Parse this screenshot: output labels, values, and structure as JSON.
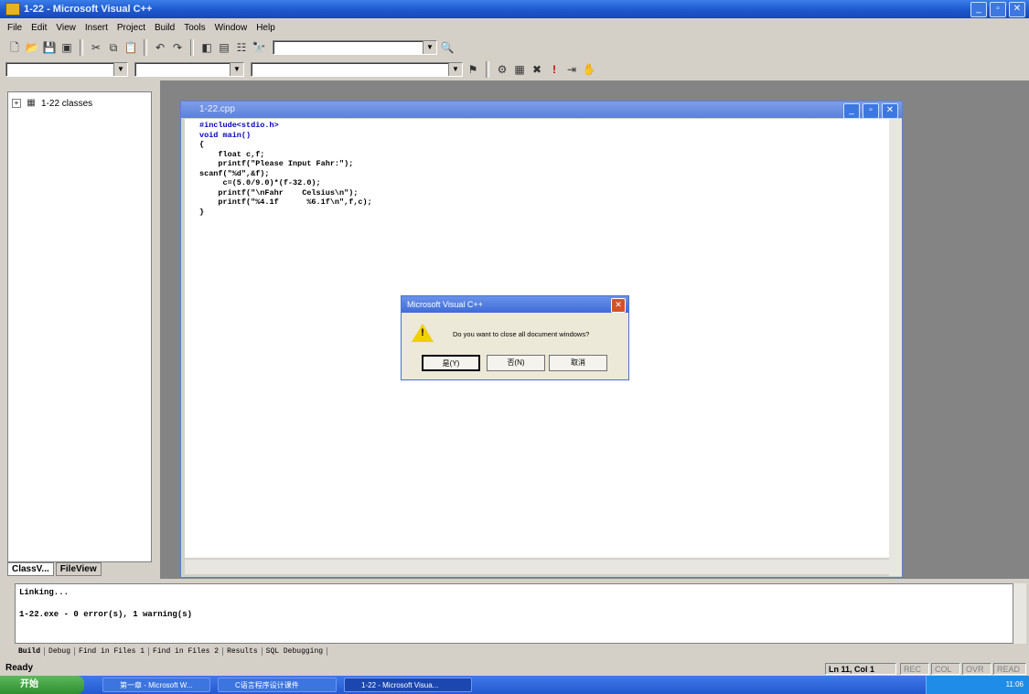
{
  "window": {
    "title": "1-22 - Microsoft Visual C++"
  },
  "menu": [
    "File",
    "Edit",
    "View",
    "Insert",
    "Project",
    "Build",
    "Tools",
    "Window",
    "Help"
  ],
  "workspace": {
    "tree_root": "1-22 classes",
    "tabs": [
      "ClassV...",
      "FileView"
    ]
  },
  "editor": {
    "title": "1-22.cpp",
    "code": [
      "#include<stdio.h>",
      "void main()",
      "{",
      "    float c,f;",
      "    printf(\"Please Input Fahr:\");",
      "scanf(\"%d\",&f);",
      "     c=(5.0/9.0)*(f-32.0);",
      "    printf(\"\\nFahr    Celsius\\n\");",
      "    printf(\"%4.1f      %6.1f\\n\",f,c);",
      "}"
    ]
  },
  "dialog": {
    "title": "Microsoft Visual C++",
    "message": "Do you want to close all document windows?",
    "buttons": [
      "是(Y)",
      "否(N)",
      "取消"
    ]
  },
  "output": {
    "lines": [
      "Linking...",
      "1-22.exe - 0 error(s), 1 warning(s)"
    ],
    "tabs": [
      "Build",
      "Debug",
      "Find in Files 1",
      "Find in Files 2",
      "Results",
      "SQL Debugging"
    ]
  },
  "status": {
    "ready": "Ready",
    "position": "Ln 11, Col 1",
    "indicators": [
      "REC",
      "COL",
      "OVR",
      "READ"
    ]
  },
  "taskbar": {
    "start": "开始",
    "tasks": [
      "第一章 - Microsoft W...",
      "C语言程序设计课件",
      "1-22 - Microsoft Visua..."
    ],
    "clock": "11:06"
  }
}
